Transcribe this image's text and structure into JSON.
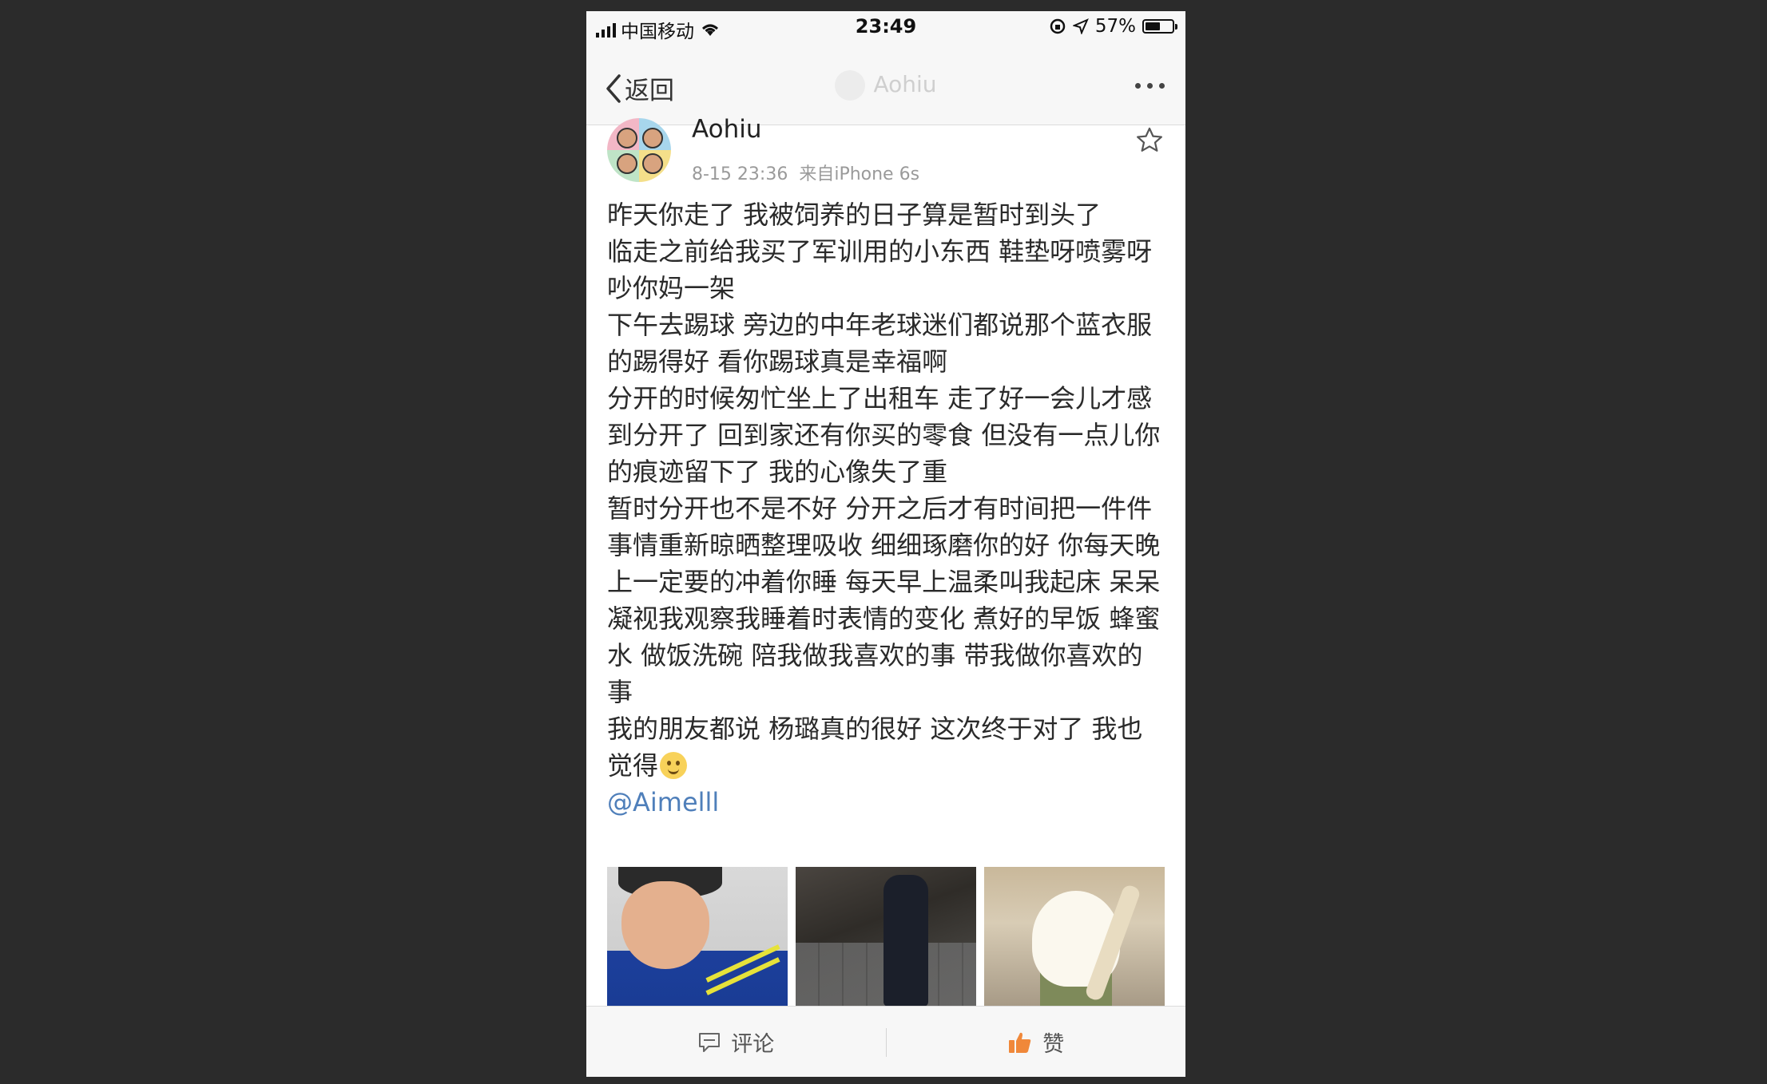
{
  "status_bar": {
    "carrier": "中国移动",
    "time": "23:49",
    "battery_percent": "57%",
    "battery_level": 0.57
  },
  "nav": {
    "back_label": "返回",
    "title": "Aohiu"
  },
  "post": {
    "author": "Aohiu",
    "time": "8-15 23:36",
    "source": "来自iPhone 6s",
    "lines": [
      "昨天你走了 我被饲养的日子算是暂时到头了",
      "临走之前给我买了军训用的小东西 鞋垫呀喷雾呀",
      "吵你妈一架",
      "下午去踢球 旁边的中年老球迷们都说那个蓝衣服的踢得好 看你踢球真是幸福啊",
      "分开的时候匆忙坐上了出租车 走了好一会儿才感到分开了 回到家还有你买的零食 但没有一点儿你的痕迹留下了 我的心像失了重",
      "暂时分开也不是不好 分开之后才有时间把一件件事情重新晾晒整理吸收 细细琢磨你的好 你每天晚上一定要的冲着你睡 每天早上温柔叫我起床 呆呆凝视我观察我睡着时表情的变化 煮好的早饭 蜂蜜水 做饭洗碗 陪我做我喜欢的事 带我做你喜欢的事",
      "我的朋友都说 杨璐真的很好 这次终于对了 我也觉得"
    ],
    "mention": "@Aimelll",
    "emoji_icon": "smile-emoji-icon"
  },
  "toolbar": {
    "comment_label": "评论",
    "like_label": "赞",
    "like_color": "#f0883a"
  }
}
